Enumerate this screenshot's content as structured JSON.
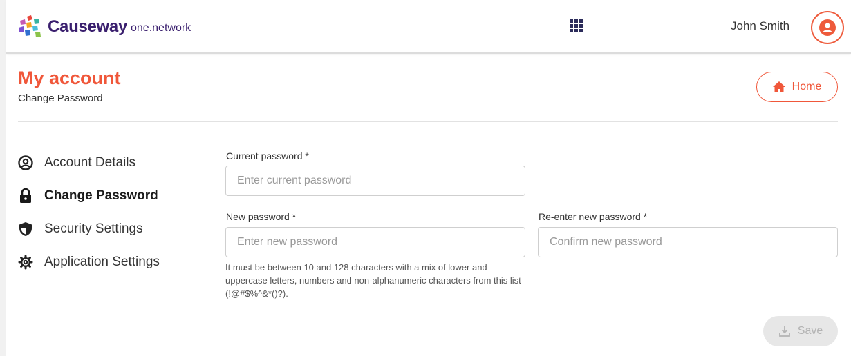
{
  "header": {
    "brand": "Causeway",
    "brand_sub": "one.network",
    "user_name": "John Smith",
    "apps_icon": "grid-icon",
    "avatar_icon": "user-icon"
  },
  "page": {
    "title": "My account",
    "subtitle": "Change Password",
    "home_label": "Home"
  },
  "sidebar": {
    "items": [
      {
        "label": "Account Details",
        "icon": "user-circle-icon",
        "active": false
      },
      {
        "label": "Change Password",
        "icon": "lock-icon",
        "active": true
      },
      {
        "label": "Security Settings",
        "icon": "shield-icon",
        "active": false
      },
      {
        "label": "Application Settings",
        "icon": "gear-icon",
        "active": false
      }
    ]
  },
  "form": {
    "current": {
      "label": "Current password *",
      "placeholder": "Enter current password",
      "value": ""
    },
    "new": {
      "label": "New password *",
      "placeholder": "Enter new password",
      "value": ""
    },
    "confirm": {
      "label": "Re-enter new password *",
      "placeholder": "Confirm new password",
      "value": ""
    },
    "hint": "It must be between 10 and 128 characters with a mix of lower and uppercase letters, numbers and non-alphanumeric characters from this list (!@#$%^&*()?).",
    "save_label": "Save"
  },
  "colors": {
    "accent": "#f0573a",
    "brand_purple": "#3a1f6e",
    "disabled_bg": "#e7e7e7",
    "disabled_text": "#b3b3b3"
  }
}
